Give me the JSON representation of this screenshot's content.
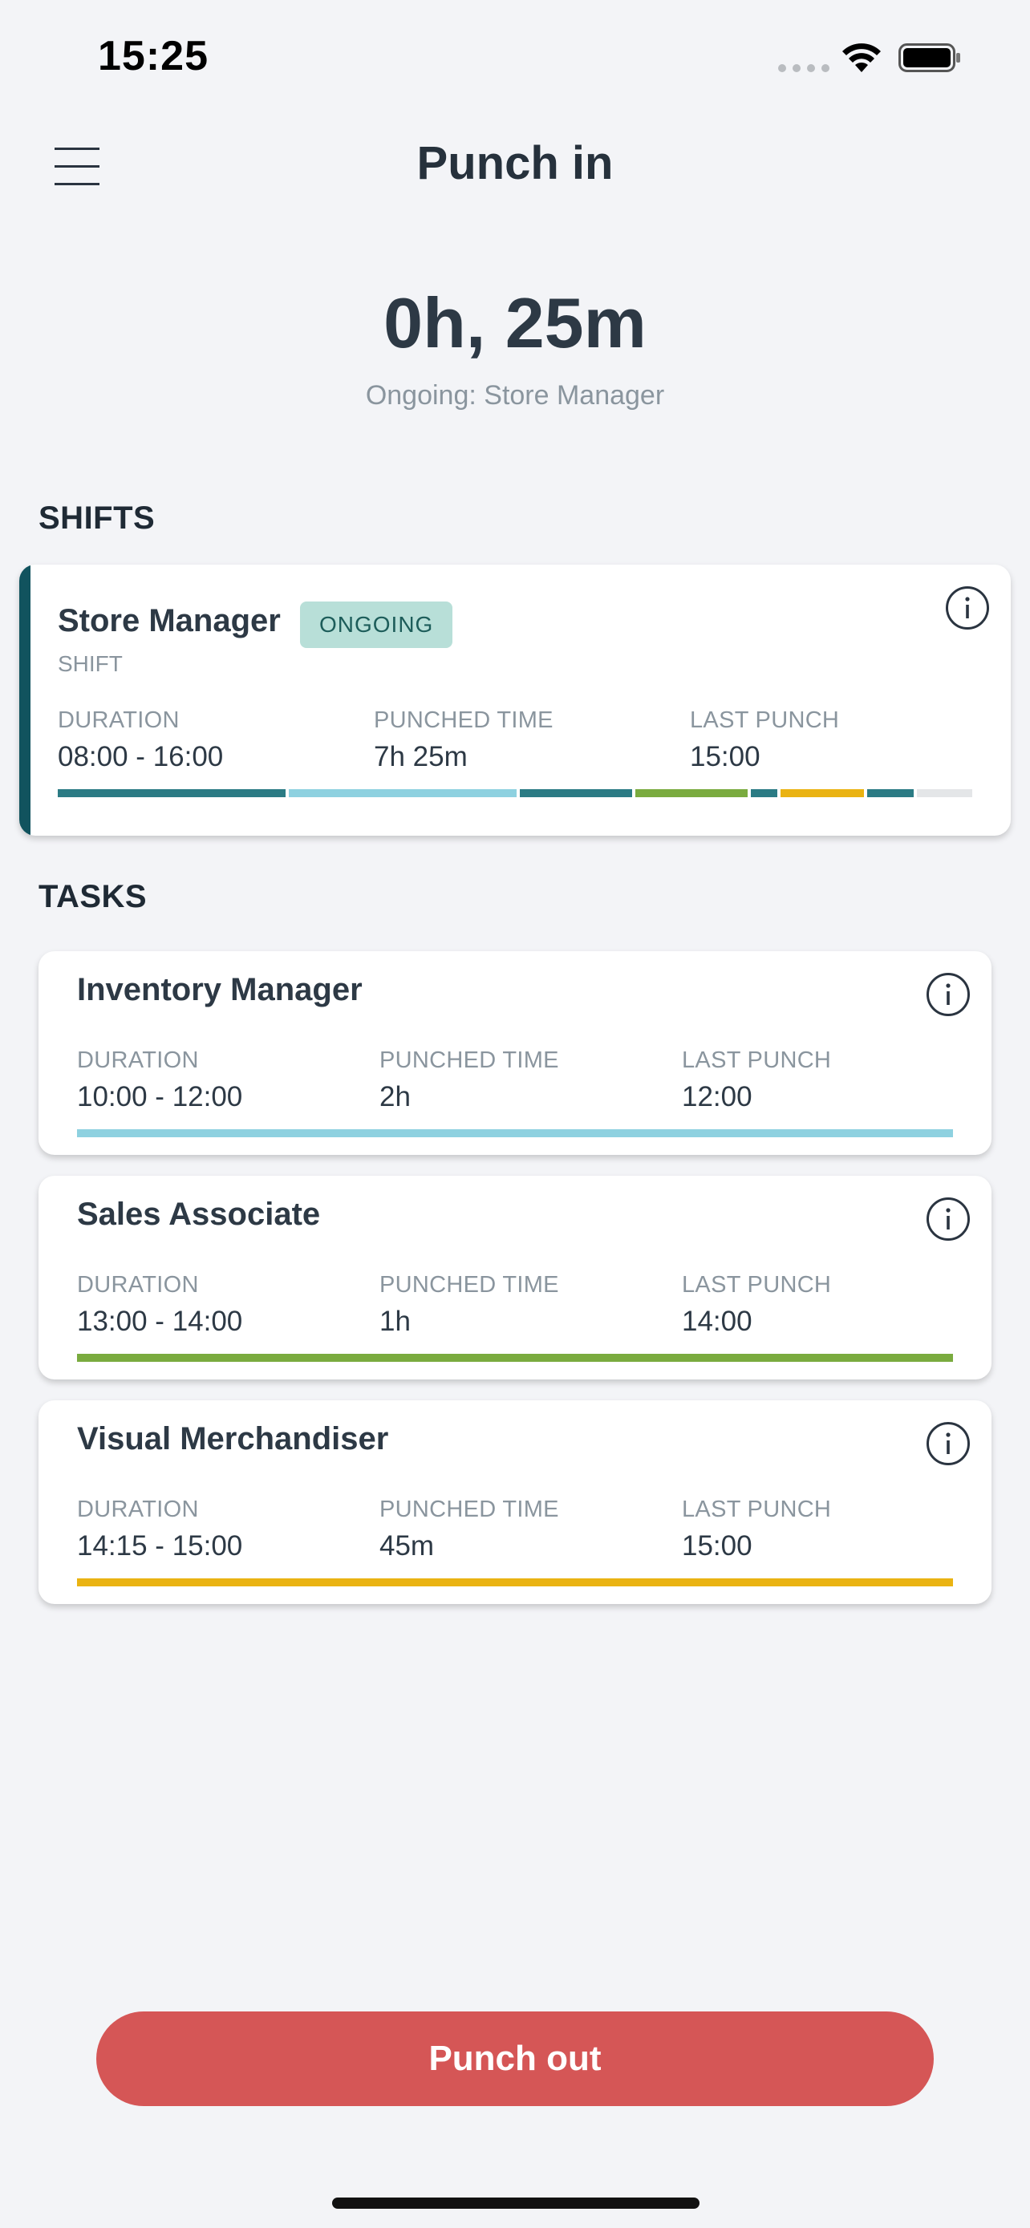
{
  "status_bar": {
    "time": "15:25"
  },
  "header": {
    "title": "Punch in"
  },
  "timer": {
    "value": "0h, 25m",
    "subtitle": "Ongoing: Store Manager"
  },
  "sections": {
    "shifts": "SHIFTS",
    "tasks": "TASKS"
  },
  "columns": {
    "duration": "DURATION",
    "punched": "PUNCHED TIME",
    "last": "LAST PUNCH"
  },
  "shift": {
    "title": "Store Manager",
    "badge": "ONGOING",
    "subtitle": "SHIFT",
    "duration": "08:00 - 16:00",
    "punched": "7h 25m",
    "last_punch": "15:00"
  },
  "tasks": [
    {
      "title": "Inventory Manager",
      "duration": "10:00 - 12:00",
      "punched": "2h",
      "last_punch": "12:00",
      "color": "#8ed1e0"
    },
    {
      "title": "Sales Associate",
      "duration": "13:00 - 14:00",
      "punched": "1h",
      "last_punch": "14:00",
      "color": "#7aab3f"
    },
    {
      "title": "Visual Merchandiser",
      "duration": "14:15 - 15:00",
      "punched": "45m",
      "last_punch": "15:00",
      "color": "#eab312"
    }
  ],
  "colors": {
    "accent": "#11535e",
    "shift_bar": "#2b7b84",
    "remaining": "#e4e6e8",
    "punch_out": "#d55656"
  },
  "actions": {
    "punch_out": "Punch out"
  }
}
